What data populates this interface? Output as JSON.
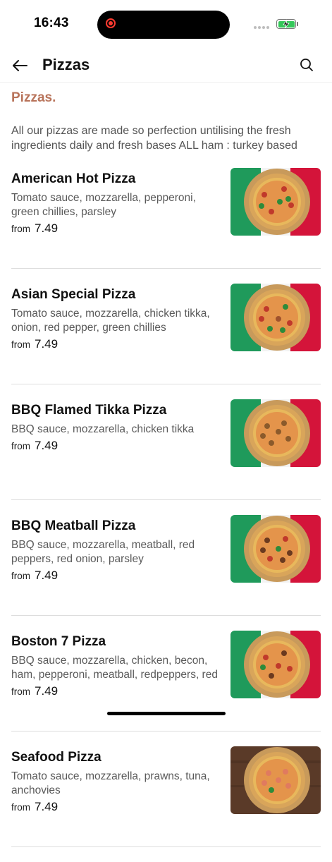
{
  "status_bar": {
    "time": "16:43"
  },
  "nav": {
    "title": "Pizzas"
  },
  "section": {
    "title": "Pizzas.",
    "description": "All our pizzas are made so perfection untilising the fresh ingredients daily and fresh bases ALL ham : turkey based"
  },
  "items": [
    {
      "name": "American Hot Pizza",
      "description": "Tomato sauce, mozzarella, pepperoni, green chillies, parsley",
      "from_label": "from",
      "price": "7.49",
      "image_style": "flag"
    },
    {
      "name": "Asian Special Pizza",
      "description": "Tomato sauce, mozzarella, chicken tikka, onion, red pepper, green chillies",
      "from_label": "from",
      "price": "7.49",
      "image_style": "flag"
    },
    {
      "name": "BBQ Flamed Tikka Pizza",
      "description": "BBQ sauce, mozzarella, chicken tikka",
      "from_label": "from",
      "price": "7.49",
      "image_style": "flag"
    },
    {
      "name": "BBQ Meatball Pizza",
      "description": "BBQ sauce, mozzarella, meatball, red peppers, red onion, parsley",
      "from_label": "from",
      "price": "7.49",
      "image_style": "flag"
    },
    {
      "name": "Boston 7 Pizza",
      "description": "BBQ sauce, mozzarella, chicken, becon, ham, pepperoni, meatball, redpeppers, red",
      "from_label": "from",
      "price": "7.49",
      "image_style": "flag"
    },
    {
      "name": "Seafood Pizza",
      "description": "Tomato sauce, mozzarella, prawns, tuna, anchovies",
      "from_label": "from",
      "price": "7.49",
      "image_style": "wood"
    }
  ],
  "colors": {
    "accent": "#b8735a",
    "flag_green": "#1f9a5b",
    "flag_white": "#f3f3f3",
    "flag_red": "#d4143a"
  }
}
